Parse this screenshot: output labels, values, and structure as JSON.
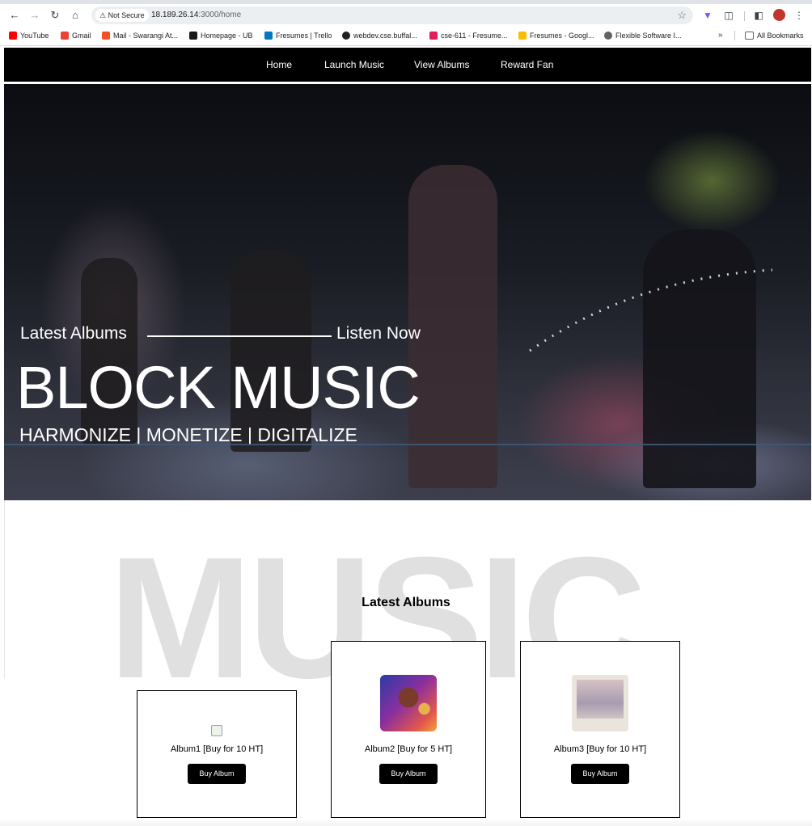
{
  "browser": {
    "security_label": "Not Secure",
    "url_host": "18.189.26.14",
    "url_path": ":3000/home",
    "icons": [
      "back-icon",
      "forward-icon",
      "reload-icon",
      "home-icon",
      "warning-icon",
      "star-icon",
      "extension-icon",
      "puzzle-icon",
      "sidepanel-icon",
      "kebab-menu-icon"
    ]
  },
  "bookmarks": [
    {
      "label": "YouTube",
      "color": "#ff0000"
    },
    {
      "label": "Gmail",
      "color": "#ea4335"
    },
    {
      "label": "Mail - Swarangi At...",
      "color": "#f25022"
    },
    {
      "label": "Homepage - UB",
      "color": "#1a1a1a"
    },
    {
      "label": "Fresumes | Trello",
      "color": "#0079bf"
    },
    {
      "label": "webdev.cse.buffal...",
      "color": "#202124"
    },
    {
      "label": "cse-611 - Fresume...",
      "color": "#e01e5a"
    },
    {
      "label": "Fresumes - Googl...",
      "color": "#fbbc04"
    },
    {
      "label": "Flexible Software I...",
      "color": "#5f6368"
    }
  ],
  "bookmarks_more": "»",
  "all_bookmarks": "All Bookmarks",
  "nav": {
    "items": [
      "Home",
      "Launch Music",
      "View Albums",
      "Reward Fan"
    ]
  },
  "hero": {
    "tagline_left": "Latest Albums",
    "tagline_right": "Listen Now",
    "title": "BLOCK MUSIC",
    "subtitle": "HARMONIZE | MONETIZE | DIGITALIZE"
  },
  "background_word": "MUSIC",
  "section_title": "Latest Albums",
  "albums": [
    {
      "title": "Album1 [Buy for 10 HT]",
      "button": "Buy Album"
    },
    {
      "title": "Album2 [Buy for 5 HT]",
      "button": "Buy Album"
    },
    {
      "title": "Album3 [Buy for 10 HT]",
      "button": "Buy Album"
    }
  ],
  "colors": {
    "nav_bg": "#000000",
    "button_bg": "#000000",
    "accent_text": "#ffffff"
  }
}
